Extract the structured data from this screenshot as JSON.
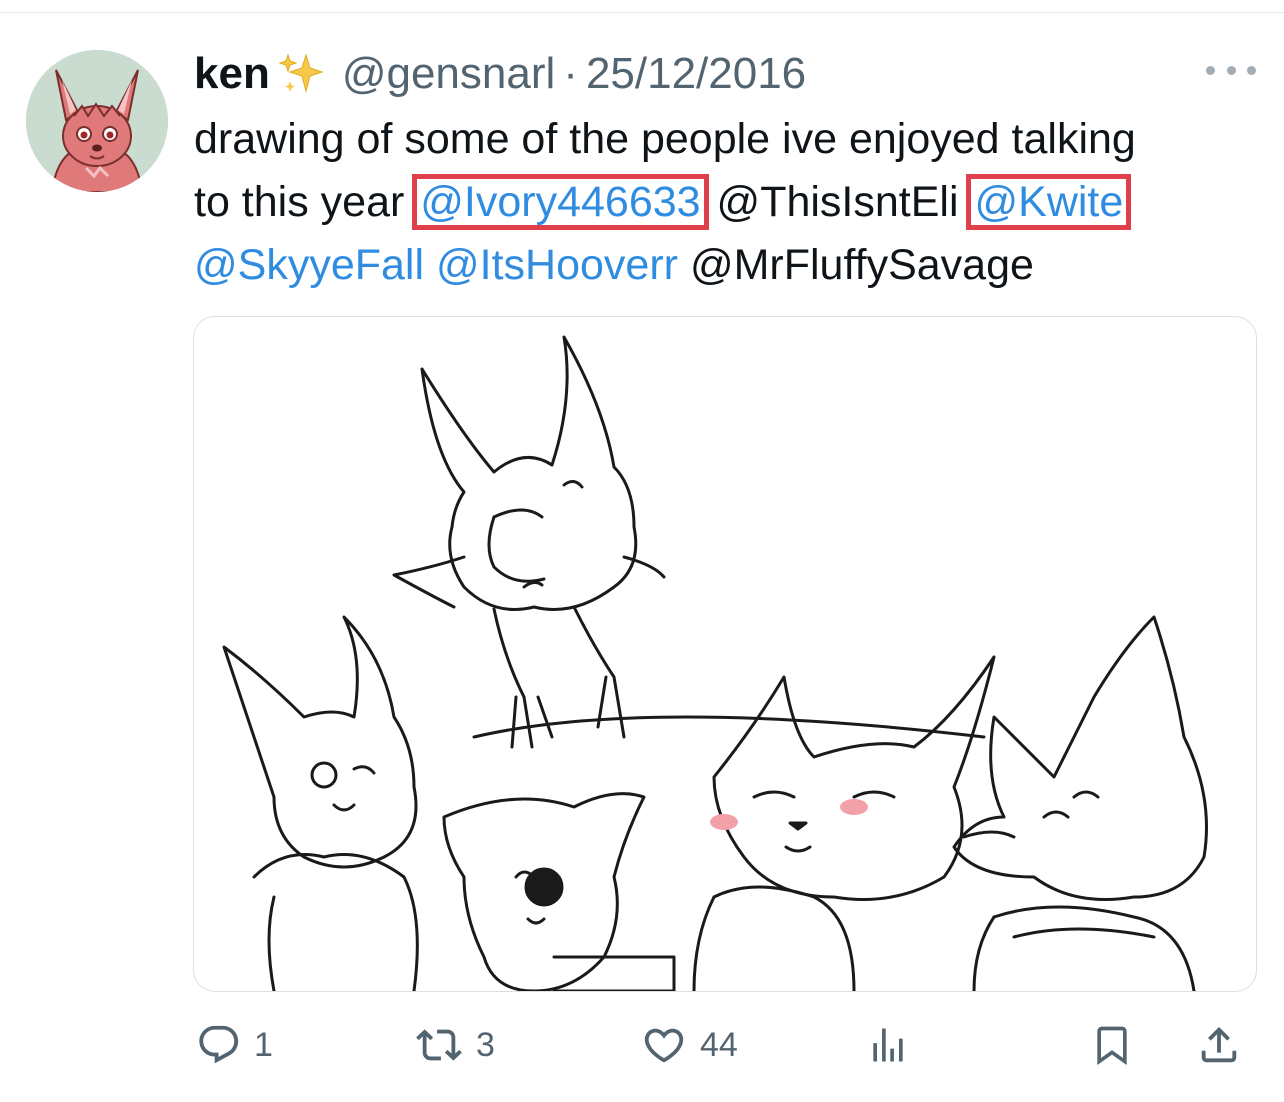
{
  "tweet": {
    "author_name": "ken",
    "author_handle": "@gensnarl",
    "separator": "·",
    "date": "25/12/2016",
    "text_line1": "drawing of some of the people ive enjoyed talking",
    "text_line2_prefix": "to this year ",
    "mentions": [
      "@Ivory446633",
      "@ThisIsntEli",
      "@Kwite",
      "@SkyyeFall",
      "@ItsHooverr",
      "@MrFluffySavage"
    ],
    "highlighted_mentions": [
      "@Ivory446633",
      "@Kwite"
    ]
  },
  "icons": {
    "name_decoration": "sparkles-icon",
    "more": "more-options-icon",
    "reply": "reply-icon",
    "retweet": "retweet-icon",
    "like": "heart-icon",
    "views": "bar-chart-icon",
    "bookmark": "bookmark-icon",
    "share": "share-icon"
  },
  "actions": {
    "reply_count": "1",
    "retweet_count": "3",
    "like_count": "44"
  },
  "colors": {
    "mention": "#2f8ce0",
    "highlight_box": "#e0404b",
    "secondary_text": "#536471",
    "avatar_bg": "#c9dccf",
    "character_fur": "#e07a7a"
  }
}
